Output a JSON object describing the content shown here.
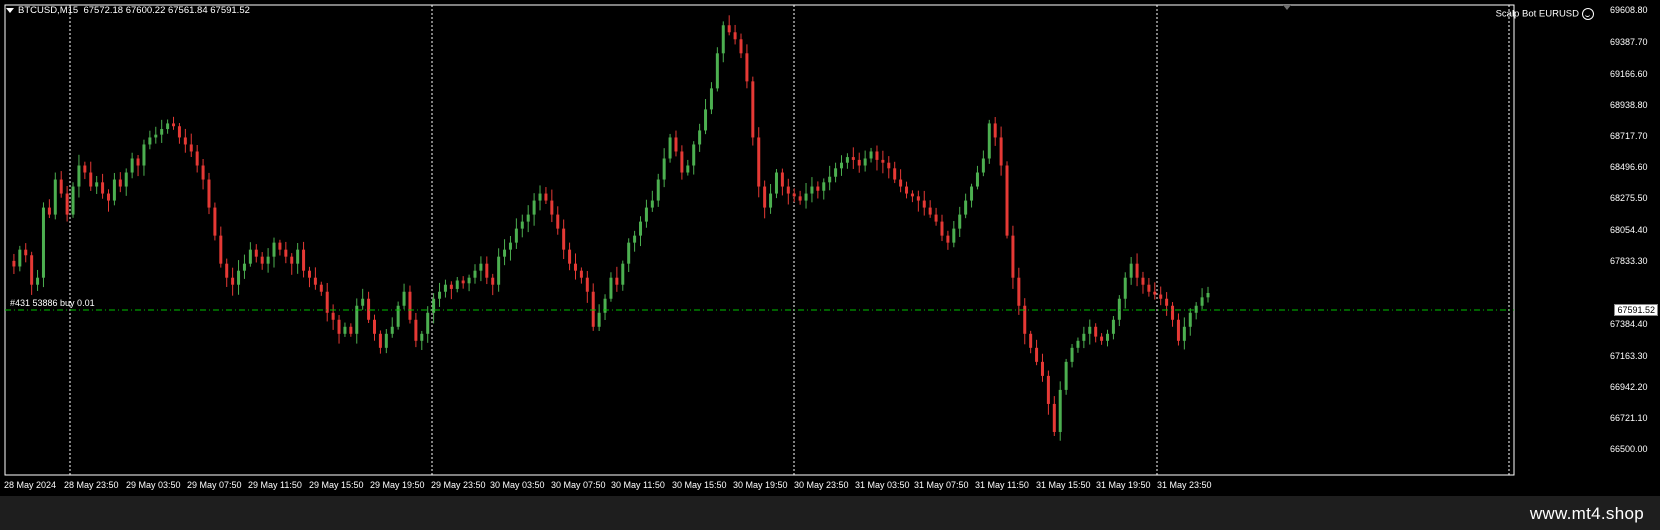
{
  "chart_header": {
    "symbol": "BTCUSD,M15",
    "ohlc": "67572.18 67600.22 67561.84 67591.52"
  },
  "expert_advisor": {
    "name": "Scalp Bot EURUSD",
    "icon": "smiley-icon"
  },
  "order_line": {
    "label": "#431 53886 buy 0.01",
    "color": "#00c000"
  },
  "current_price": "67591.52",
  "colors": {
    "background": "#000000",
    "bull": "#4caf50",
    "bear": "#e53935",
    "grid": "#ffffff",
    "footer": "#1e1e1e"
  },
  "price_axis": [
    "69608.80",
    "69387.70",
    "69166.60",
    "68938.80",
    "68717.70",
    "68496.60",
    "68275.50",
    "68054.40",
    "67833.30",
    "67384.40",
    "67163.30",
    "66942.20",
    "66721.10",
    "66500.00"
  ],
  "time_axis": [
    "28 May 2024",
    "28 May 23:50",
    "29 May 03:50",
    "29 May 07:50",
    "29 May 11:50",
    "29 May 15:50",
    "29 May 19:50",
    "29 May 23:50",
    "30 May 03:50",
    "30 May 07:50",
    "30 May 11:50",
    "30 May 15:50",
    "30 May 19:50",
    "30 May 23:50",
    "31 May 03:50",
    "31 May 07:50",
    "31 May 11:50",
    "31 May 15:50",
    "31 May 19:50",
    "31 May 23:50"
  ],
  "footer": {
    "brand": "www.mt4.shop"
  },
  "chart_data": {
    "type": "candlestick",
    "ylim": [
      66500.0,
      69608.8
    ],
    "price_path": [
      67820,
      67780,
      67900,
      67860,
      67650,
      67700,
      68200,
      68150,
      68400,
      68300,
      68150,
      68350,
      68500,
      68450,
      68350,
      68380,
      68300,
      68250,
      68400,
      68350,
      68450,
      68550,
      68500,
      68650,
      68700,
      68720,
      68760,
      68800,
      68780,
      68700,
      68650,
      68600,
      68500,
      68400,
      68200,
      68000,
      67800,
      67700,
      67650,
      67750,
      67800,
      67900,
      67850,
      67800,
      67850,
      67950,
      67900,
      67850,
      67800,
      67900,
      67750,
      67700,
      67650,
      67600,
      67450,
      67400,
      67300,
      67350,
      67300,
      67500,
      67550,
      67400,
      67300,
      67200,
      67300,
      67350,
      67500,
      67600,
      67400,
      67250,
      67300,
      67450,
      67550,
      67600,
      67650,
      67620,
      67680,
      67660,
      67700,
      67750,
      67800,
      67700,
      67650,
      67850,
      67900,
      67950,
      68050,
      68100,
      68150,
      68250,
      68300,
      68250,
      68150,
      68050,
      67900,
      67800,
      67750,
      67700,
      67600,
      67350,
      67450,
      67550,
      67700,
      67650,
      67800,
      67950,
      68000,
      68100,
      68200,
      68250,
      68400,
      68550,
      68700,
      68600,
      68450,
      68500,
      68650,
      68750,
      68900,
      69050,
      69300,
      69500,
      69450,
      69400,
      69300,
      69100,
      68700,
      68350,
      68200,
      68300,
      68450,
      68350,
      68300,
      68280,
      68250,
      68300,
      68350,
      68320,
      68380,
      68420,
      68480,
      68520,
      68560,
      68540,
      68500,
      68550,
      68600,
      68540,
      68520,
      68480,
      68400,
      68350,
      68300,
      68280,
      68250,
      68200,
      68150,
      68100,
      68000,
      67950,
      68050,
      68150,
      68250,
      68350,
      68450,
      68550,
      68800,
      68700,
      68500,
      68000,
      67700,
      67500,
      67300,
      67200,
      67100,
      67000,
      66800,
      66600,
      66900,
      67100,
      67200,
      67250,
      67300,
      67350,
      67280,
      67250,
      67300,
      67400,
      67550,
      67700,
      67800,
      67700,
      67650,
      67600,
      67580,
      67550,
      67500,
      67400,
      67250,
      67350,
      67450,
      67500,
      67560,
      67591
    ]
  }
}
